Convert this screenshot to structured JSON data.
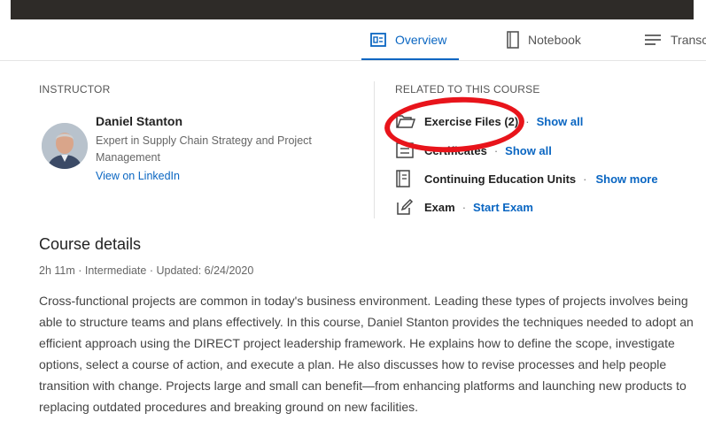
{
  "tabs": [
    {
      "label": "Overview",
      "active": true,
      "icon": "overview-icon"
    },
    {
      "label": "Notebook",
      "active": false,
      "icon": "notebook-icon"
    },
    {
      "label": "Transc",
      "active": false,
      "icon": "transcript-icon"
    }
  ],
  "instructor": {
    "section_label": "INSTRUCTOR",
    "name": "Daniel Stanton",
    "title": "Expert in Supply Chain Strategy and Project Management",
    "link": "View on LinkedIn"
  },
  "related": {
    "section_label": "RELATED TO THIS COURSE",
    "items": [
      {
        "icon": "folder-icon",
        "name": "Exercise Files (2)",
        "separator": "·",
        "link": "Show all"
      },
      {
        "icon": "certificate-icon",
        "name": "Certificates",
        "separator": "·",
        "link": "Show all"
      },
      {
        "icon": "ceu-document-icon",
        "name": "Continuing Education Units",
        "separator": "·",
        "link": "Show more"
      },
      {
        "icon": "exam-pencil-icon",
        "name": "Exam",
        "separator": "·",
        "link": "Start Exam"
      }
    ]
  },
  "course_details": {
    "title": "Course details",
    "meta": "2h 11m · Intermediate · Updated: 6/24/2020",
    "description": "Cross-functional projects are common in today's business environment. Leading these types of projects involves being able to structure teams and plans effectively. In this course, Daniel Stanton provides the techniques needed to adopt an efficient approach using the DIRECT project leadership framework. He explains how to define the scope, investigate options, select a course of action, and execute a plan. He also discusses how to revise processes and help people transition with change. Projects large and small can benefit—from enhancing platforms and launching new products to replacing outdated procedures and breaking ground on new facilities."
  },
  "colors": {
    "accent": "#0a66c2",
    "annotation": "#e8141b"
  }
}
